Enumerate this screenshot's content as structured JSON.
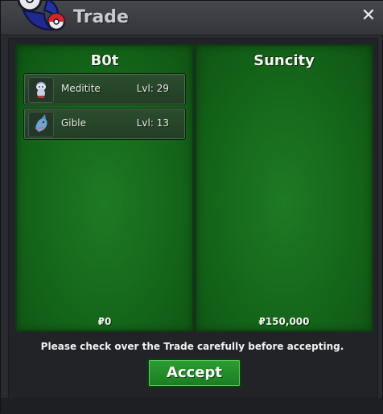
{
  "window": {
    "title": "Trade",
    "close_icon": "close-icon"
  },
  "left_panel": {
    "player": "B0t",
    "items": [
      {
        "name": "Meditite",
        "level": "Lvl: 29",
        "icon": "meditite-icon"
      },
      {
        "name": "Gible",
        "level": "Lvl: 13",
        "icon": "gible-icon"
      }
    ],
    "money": "₽0"
  },
  "right_panel": {
    "player": "Suncity",
    "items": [],
    "money": "₽150,000"
  },
  "notice": "Please check over the Trade carefully before accepting.",
  "accept_label": "Accept",
  "colors": {
    "panel_green": "#166a1c",
    "button_green": "#22912a",
    "window_bg": "#2a2b30"
  }
}
